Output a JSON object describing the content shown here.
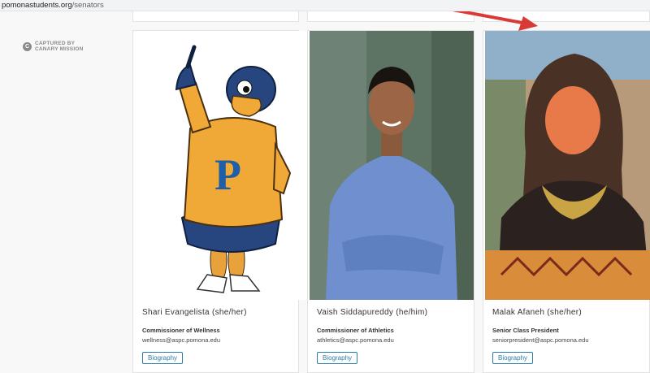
{
  "address_bar": {
    "host": "pomonastudents.org",
    "path": "/senators"
  },
  "watermark": {
    "icon": "c-circle-icon",
    "line1": "CAPTURED BY",
    "line2": "CANARY MISSION"
  },
  "senators": [
    {
      "name": "Shari Evangelista (she/her)",
      "role": "Commissioner of Wellness",
      "email": "wellness@aspc.pomona.edu",
      "button": "Biography",
      "photo": "cartoon-sagehen-mascot"
    },
    {
      "name": "Vaish Siddapureddy (he/him)",
      "role": "Commissioner of Athletics",
      "email": "athletics@aspc.pomona.edu",
      "button": "Biography",
      "photo": "man-blue-shirt-outdoors"
    },
    {
      "name": "Malak Afaneh (she/her)",
      "role": "Senior Class President",
      "email": "seniorpresident@aspc.pomona.edu",
      "button": "Biography",
      "photo": "woman-headscarf-outdoors"
    }
  ],
  "colors": {
    "link": "#2b7ea8",
    "annotation_arrow": "#d93a35"
  }
}
